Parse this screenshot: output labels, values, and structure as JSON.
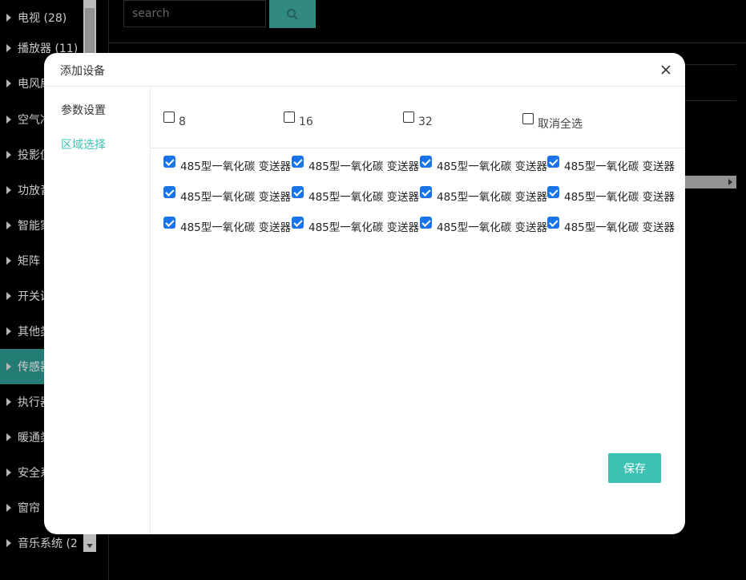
{
  "sidebar": {
    "items": [
      {
        "label": "电视 (28)",
        "active": false
      },
      {
        "label": "播放器 (11)",
        "active": false
      },
      {
        "label": "电风扇",
        "active": false
      },
      {
        "label": "空气净",
        "active": false
      },
      {
        "label": "投影仪",
        "active": false
      },
      {
        "label": "功放音",
        "active": false
      },
      {
        "label": "智能家",
        "active": false
      },
      {
        "label": "矩阵",
        "active": false
      },
      {
        "label": "开关设",
        "active": false
      },
      {
        "label": "其他类",
        "active": false
      },
      {
        "label": "传感器",
        "active": true
      },
      {
        "label": "执行器",
        "active": false
      },
      {
        "label": "暖通类",
        "active": false
      },
      {
        "label": "安全系",
        "active": false
      },
      {
        "label": "窗帘",
        "active": false
      },
      {
        "label": "音乐系统 (2",
        "active": false
      }
    ]
  },
  "search": {
    "placeholder": "search",
    "button_icon": "search-icon"
  },
  "modal": {
    "title": "添加设备",
    "close_icon": "close-icon",
    "nav": [
      {
        "label": "参数设置",
        "active": false
      },
      {
        "label": "区域选择",
        "active": true
      }
    ],
    "group_options": [
      {
        "label": "8",
        "checked": false
      },
      {
        "label": "16",
        "checked": false
      },
      {
        "label": "32",
        "checked": false
      },
      {
        "label": "取消全选",
        "checked": false
      }
    ],
    "devices": [
      {
        "label": "485型一氧化碳 变送器",
        "checked": true
      },
      {
        "label": "485型一氧化碳 变送器",
        "checked": true
      },
      {
        "label": "485型一氧化碳 变送器",
        "checked": true
      },
      {
        "label": "485型一氧化碳 变送器",
        "checked": true
      },
      {
        "label": "485型一氧化碳 变送器",
        "checked": true
      },
      {
        "label": "485型一氧化碳 变送器",
        "checked": true
      },
      {
        "label": "485型一氧化碳 变送器",
        "checked": true
      },
      {
        "label": "485型一氧化碳 变送器",
        "checked": true
      },
      {
        "label": "485型一氧化碳 变送器",
        "checked": true
      },
      {
        "label": "485型一氧化碳 变送器",
        "checked": true
      },
      {
        "label": "485型一氧化碳 变送器",
        "checked": true
      },
      {
        "label": "485型一氧化碳 变送器",
        "checked": true
      }
    ],
    "save_label": "保存"
  },
  "colors": {
    "accent": "#3cc2b5",
    "sidebar_active": "#2a8f84",
    "checkbox": "#1a73e8"
  }
}
